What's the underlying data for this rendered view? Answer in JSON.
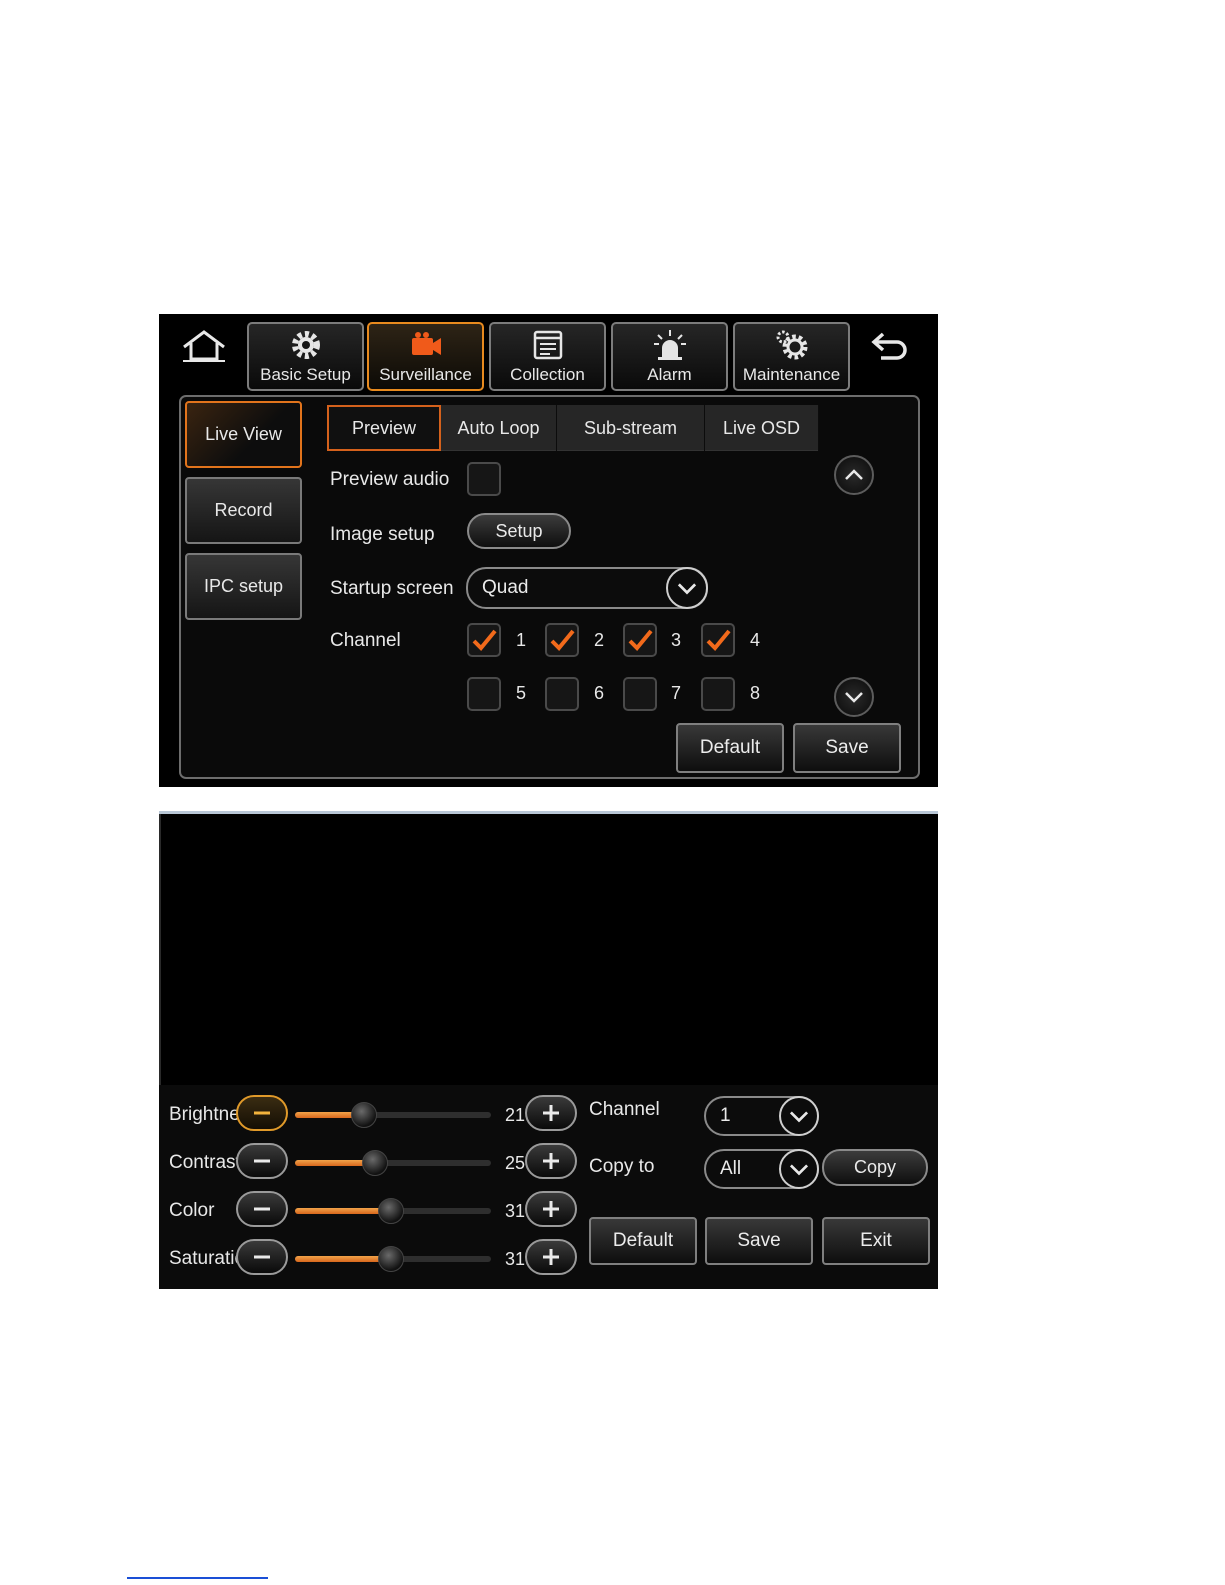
{
  "main_menu": {
    "tabs": [
      {
        "label": "Basic Setup",
        "icon": "gear-icon"
      },
      {
        "label": "Surveillance",
        "icon": "camera-icon"
      },
      {
        "label": "Collection",
        "icon": "window-icon"
      },
      {
        "label": "Alarm",
        "icon": "alarm-light-icon"
      },
      {
        "label": "Maintenance",
        "icon": "gears-icon"
      }
    ],
    "active_tab": "Surveillance"
  },
  "side_menu": {
    "items": [
      {
        "label": "Live View"
      },
      {
        "label": "Record"
      },
      {
        "label": "IPC setup"
      }
    ],
    "active_item": "Live View"
  },
  "sub_tabs": {
    "items": [
      {
        "label": "Preview"
      },
      {
        "label": "Auto Loop"
      },
      {
        "label": "Sub-stream"
      },
      {
        "label": "Live OSD"
      }
    ],
    "active": "Preview"
  },
  "preview_form": {
    "preview_audio_label": "Preview audio",
    "preview_audio_checked": false,
    "image_setup_label": "Image setup",
    "setup_button": "Setup",
    "startup_screen_label": "Startup screen",
    "startup_screen_value": "Quad",
    "channel_label": "Channel",
    "channels": [
      {
        "num": "1",
        "checked": true
      },
      {
        "num": "2",
        "checked": true
      },
      {
        "num": "3",
        "checked": true
      },
      {
        "num": "4",
        "checked": true
      },
      {
        "num": "5",
        "checked": false
      },
      {
        "num": "6",
        "checked": false
      },
      {
        "num": "7",
        "checked": false
      },
      {
        "num": "8",
        "checked": false
      }
    ],
    "default_button": "Default",
    "save_button": "Save"
  },
  "image_setup": {
    "sliders": [
      {
        "label": "Brightness",
        "value": "21",
        "fraction": 0.35
      },
      {
        "label": "Contrast",
        "value": "25",
        "fraction": 0.41
      },
      {
        "label": "Color",
        "value": "31",
        "fraction": 0.49
      },
      {
        "label": "Saturation",
        "value": "31",
        "fraction": 0.49
      }
    ],
    "channel_label": "Channel",
    "channel_value": "1",
    "copy_to_label": "Copy to",
    "copy_to_value": "All",
    "copy_button": "Copy",
    "default_button": "Default",
    "save_button": "Save",
    "exit_button": "Exit"
  },
  "colors": {
    "accent": "#e8761c",
    "check": "#f26a1b",
    "slider_fill": "#e8892a"
  }
}
